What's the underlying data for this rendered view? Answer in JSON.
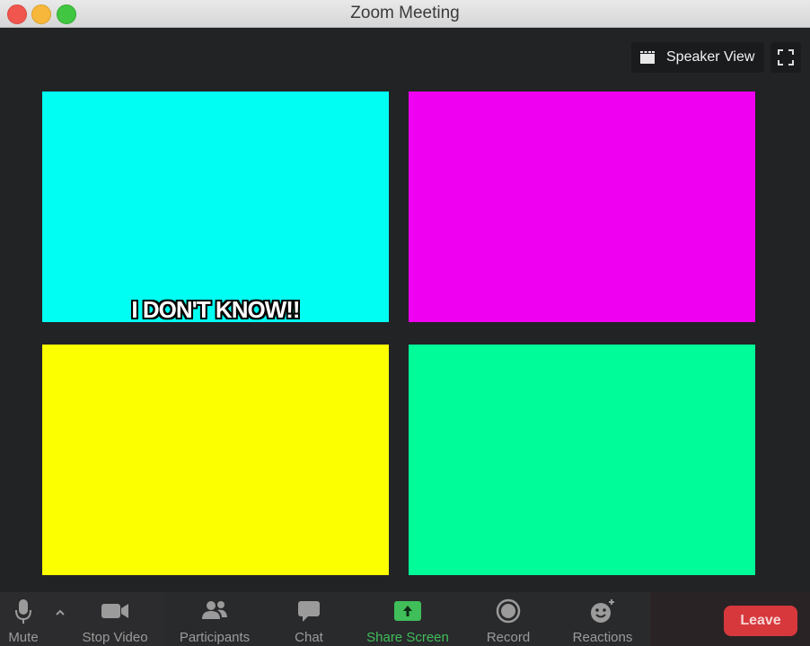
{
  "window": {
    "title": "Zoom Meeting"
  },
  "view_controls": {
    "speaker_view_label": "Speaker View"
  },
  "tiles": [
    {
      "color": "#00fff2",
      "caption": "I DON'T KNOW!!"
    },
    {
      "color": "#f000f0",
      "caption": ""
    },
    {
      "color": "#fbff00",
      "caption": ""
    },
    {
      "color": "#00fb99",
      "caption": ""
    }
  ],
  "toolbar": {
    "mute_label": "Mute",
    "stop_video_label": "Stop Video",
    "participants_label": "Participants",
    "chat_label": "Chat",
    "share_screen_label": "Share Screen",
    "record_label": "Record",
    "reactions_label": "Reactions",
    "leave_label": "Leave"
  },
  "colors": {
    "share_accent": "#3fbe5a",
    "leave_button": "#d7383c"
  },
  "icons": {
    "mute": "microphone-icon",
    "mute_options": "chevron-up-icon",
    "stop_video": "video-camera-icon",
    "participants": "participants-icon",
    "chat": "chat-bubble-icon",
    "share_screen": "share-screen-icon",
    "record": "record-icon",
    "reactions": "reactions-icon",
    "speaker_view": "grid-icon",
    "fullscreen": "fullscreen-icon"
  }
}
